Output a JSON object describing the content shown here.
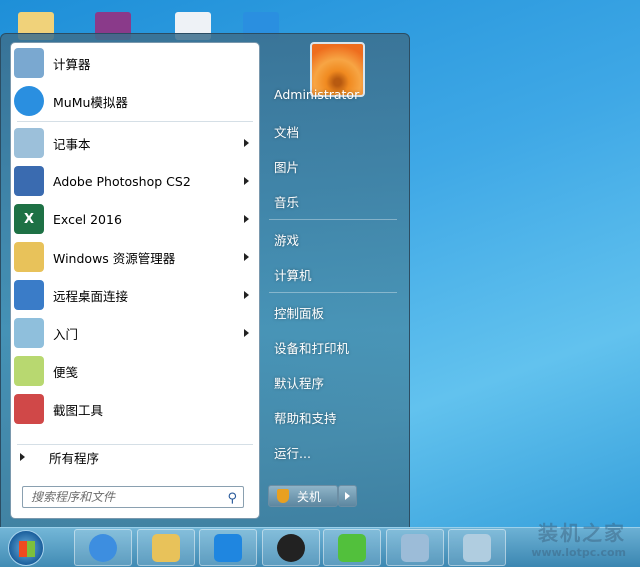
{
  "left_items": [
    {
      "label": "计算器",
      "icon": "calculator-icon",
      "color": "#7aa8d0",
      "submenu": false
    },
    {
      "label": "MuMu模拟器",
      "icon": "mumu-icon",
      "color": "#2a8fe0",
      "submenu": false
    },
    {
      "label": "记事本",
      "icon": "notepad-icon",
      "color": "#9cc0da",
      "submenu": true
    },
    {
      "label": "Adobe Photoshop CS2",
      "icon": "photoshop-icon",
      "color": "#3a6bb0",
      "submenu": true
    },
    {
      "label": "Excel 2016",
      "icon": "excel-icon",
      "color": "#1e7145",
      "glyph": "X",
      "submenu": true
    },
    {
      "label": "Windows 资源管理器",
      "icon": "explorer-icon",
      "color": "#e8c25a",
      "submenu": true
    },
    {
      "label": "远程桌面连接",
      "icon": "remote-desktop-icon",
      "color": "#3a7cc8",
      "submenu": true
    },
    {
      "label": "入门",
      "icon": "getting-started-icon",
      "color": "#8fbfdc",
      "submenu": true
    },
    {
      "label": "便笺",
      "icon": "sticky-notes-icon",
      "color": "#b8d870",
      "submenu": false
    },
    {
      "label": "截图工具",
      "icon": "snipping-tool-icon",
      "color": "#d04848",
      "submenu": false
    }
  ],
  "all_programs": "所有程序",
  "search_placeholder": "搜索程序和文件",
  "right_items": [
    "Administrator",
    "文档",
    "图片",
    "音乐",
    "游戏",
    "计算机",
    "控制面板",
    "设备和打印机",
    "默认程序",
    "帮助和支持",
    "运行..."
  ],
  "shutdown_label": "关机",
  "taskbar": [
    {
      "name": "sogou-browser",
      "color": "#3d8ee0"
    },
    {
      "name": "file-explorer",
      "color": "#e8c25a"
    },
    {
      "name": "app-blue",
      "color": "#1f86e0"
    },
    {
      "name": "media",
      "color": "#222"
    },
    {
      "name": "wechat",
      "color": "#52c03c"
    },
    {
      "name": "calculator",
      "color": "#9cbcd8"
    },
    {
      "name": "notepad",
      "color": "#b0cde0"
    }
  ],
  "watermark": {
    "title": "装机之家",
    "url": "www.lotpc.com"
  }
}
